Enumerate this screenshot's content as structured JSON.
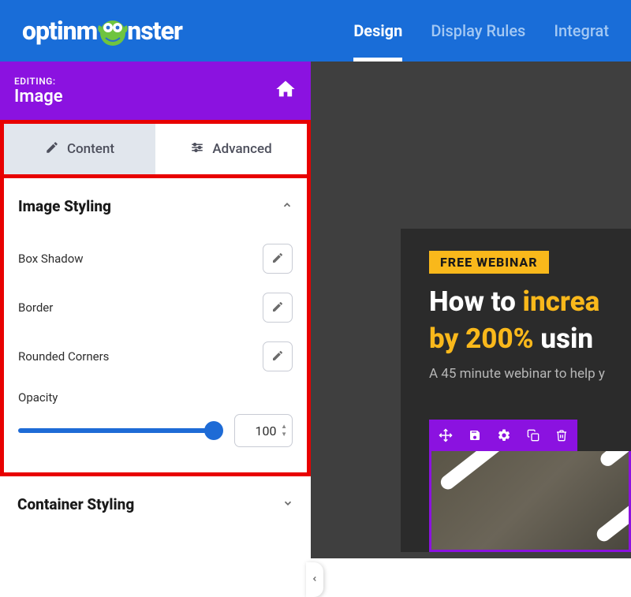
{
  "brand": {
    "name_pre": "optinm",
    "name_post": "nster"
  },
  "topnav": {
    "tabs": [
      {
        "label": "Design",
        "active": true
      },
      {
        "label": "Display Rules",
        "active": false
      },
      {
        "label": "Integrat",
        "active": false
      }
    ]
  },
  "colors": {
    "primary": "#196dd8",
    "accent": "#8b12e0",
    "highlight_box": "#e80000",
    "badge": "#f9b81b"
  },
  "sidepanel": {
    "editing_label": "EDITING:",
    "editing_value": "Image",
    "tabs": {
      "content": "Content",
      "advanced": "Advanced"
    },
    "image_styling": {
      "title": "Image Styling",
      "props": {
        "box_shadow": "Box Shadow",
        "border": "Border",
        "rounded": "Rounded Corners",
        "opacity_label": "Opacity",
        "opacity_value": "100"
      }
    },
    "container_styling": {
      "title": "Container Styling"
    }
  },
  "canvas": {
    "badge": "FREE WEBINAR",
    "heading_pre": "How to ",
    "heading_accent1": "increa",
    "heading_mid": "by 200% ",
    "heading_rest": "usin",
    "subhead": "A 45 minute webinar to help y",
    "toolbar_icons": [
      "move-icon",
      "save-icon",
      "gear-icon",
      "copy-icon",
      "trash-icon"
    ]
  }
}
